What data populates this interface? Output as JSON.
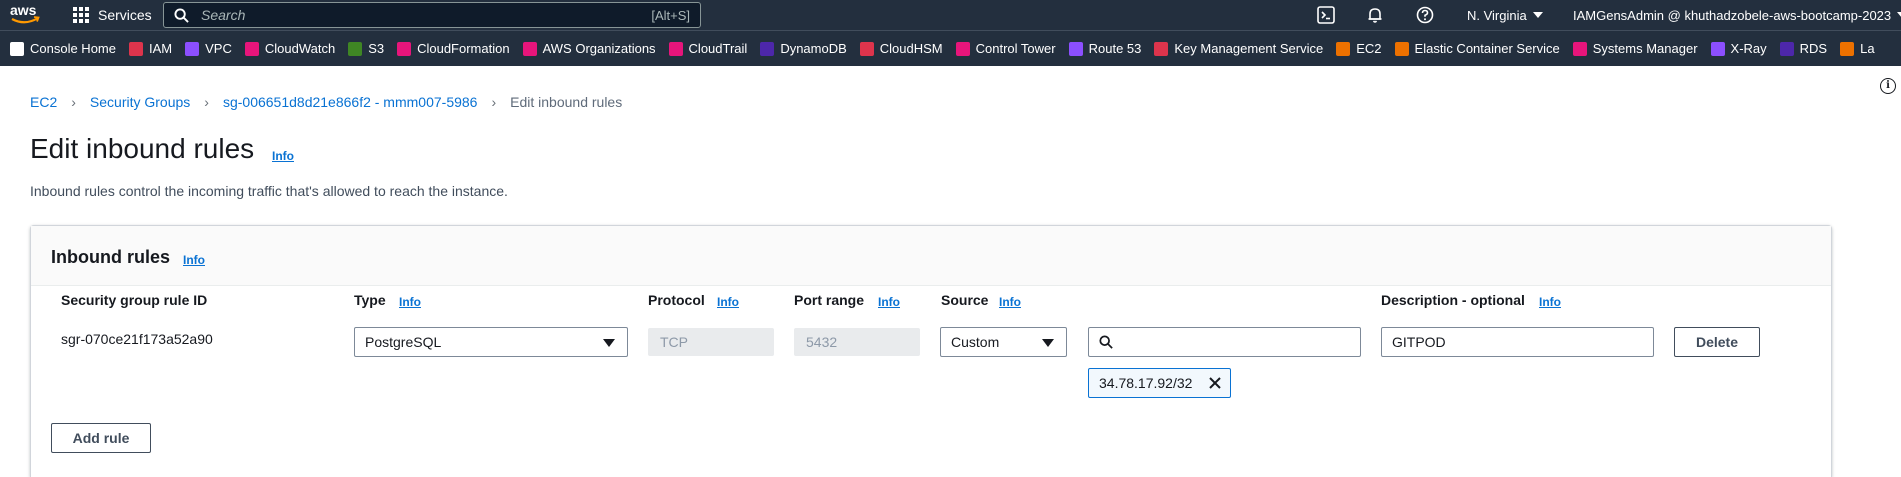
{
  "topnav": {
    "logo_text": "aws",
    "services_label": "Services",
    "search_placeholder": "Search",
    "search_shortcut": "[Alt+S]",
    "region": "N. Virginia",
    "account": "IAMGensAdmin @ khuthadzobele-aws-bootcamp-2023"
  },
  "favorites": [
    {
      "label": "Console Home",
      "icon": "home-icon",
      "color": "#ffffff"
    },
    {
      "label": "IAM",
      "icon": "iam-icon",
      "color": "#dd344c"
    },
    {
      "label": "VPC",
      "icon": "vpc-icon",
      "color": "#8c4fff"
    },
    {
      "label": "CloudWatch",
      "icon": "cloudwatch-icon",
      "color": "#e7157b"
    },
    {
      "label": "S3",
      "icon": "s3-icon",
      "color": "#3f8624"
    },
    {
      "label": "CloudFormation",
      "icon": "cloudformation-icon",
      "color": "#e7157b"
    },
    {
      "label": "AWS Organizations",
      "icon": "organizations-icon",
      "color": "#e7157b"
    },
    {
      "label": "CloudTrail",
      "icon": "cloudtrail-icon",
      "color": "#e7157b"
    },
    {
      "label": "DynamoDB",
      "icon": "dynamodb-icon",
      "color": "#4d27aa"
    },
    {
      "label": "CloudHSM",
      "icon": "cloudhsm-icon",
      "color": "#dd344c"
    },
    {
      "label": "Control Tower",
      "icon": "controltower-icon",
      "color": "#e7157b"
    },
    {
      "label": "Route 53",
      "icon": "route53-icon",
      "color": "#8c4fff"
    },
    {
      "label": "Key Management Service",
      "icon": "kms-icon",
      "color": "#dd344c"
    },
    {
      "label": "EC2",
      "icon": "ec2-icon",
      "color": "#ed7100"
    },
    {
      "label": "Elastic Container Service",
      "icon": "ecs-icon",
      "color": "#ed7100"
    },
    {
      "label": "Systems Manager",
      "icon": "systems-manager-icon",
      "color": "#e7157b"
    },
    {
      "label": "X-Ray",
      "icon": "xray-icon",
      "color": "#8c4fff"
    },
    {
      "label": "RDS",
      "icon": "rds-icon",
      "color": "#4d27aa"
    },
    {
      "label": "La",
      "icon": "lambda-icon",
      "color": "#ed7100"
    }
  ],
  "breadcrumb": {
    "items": [
      "EC2",
      "Security Groups",
      "sg-006651d8d21e866f2 - mmm007-5986"
    ],
    "current": "Edit inbound rules"
  },
  "page": {
    "title": "Edit inbound rules",
    "title_info": "Info",
    "description": "Inbound rules control the incoming traffic that's allowed to reach the instance."
  },
  "panel": {
    "title": "Inbound rules",
    "info": "Info",
    "columns": {
      "rule_id": "Security group rule ID",
      "type": "Type",
      "protocol": "Protocol",
      "port_range": "Port range",
      "source": "Source",
      "description": "Description - optional",
      "info": "Info"
    },
    "rule": {
      "id": "sgr-070ce21f173a52a90",
      "type": "PostgreSQL",
      "protocol": "TCP",
      "port_range": "5432",
      "source_type": "Custom",
      "source_search": "",
      "source_token": "34.78.17.92/32",
      "description": "GITPOD",
      "delete_label": "Delete"
    },
    "add_rule_label": "Add rule"
  },
  "colors": {
    "nav_bg": "#232f3e",
    "link": "#0972d3"
  }
}
